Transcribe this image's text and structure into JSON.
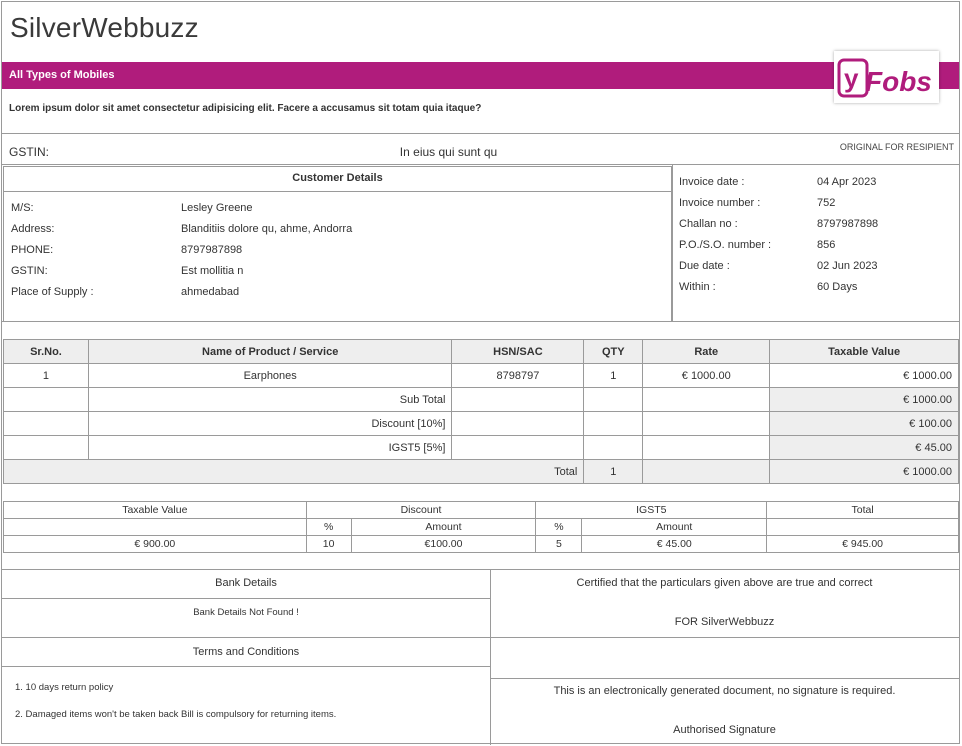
{
  "header": {
    "company_name": "SilverWebbuzz",
    "band_text": "All Types of Mobiles",
    "tagline": "Lorem ipsum dolor sit amet consectetur adipisicing elit. Facere a accusamus sit totam quia itaque?",
    "logo_text_y": "y",
    "logo_text_rest": "Fobs",
    "brand_color": "#b01c7c"
  },
  "gstin_bar": {
    "label": "GSTIN:",
    "value": "In eius qui sunt qu",
    "original_label": "ORIGINAL FOR RESIPIENT"
  },
  "customer": {
    "title": "Customer Details",
    "rows": [
      {
        "label": "M/S:",
        "value": "Lesley Greene"
      },
      {
        "label": "Address:",
        "value": "Blanditiis dolore qu, ahme, Andorra"
      },
      {
        "label": "PHONE:",
        "value": "8797987898"
      },
      {
        "label": "GSTIN:",
        "value": "Est mollitia n"
      },
      {
        "label": "Place of Supply :",
        "value": "ahmedabad"
      }
    ]
  },
  "invoice_info": [
    {
      "label": "Invoice date :",
      "value": "04 Apr 2023"
    },
    {
      "label": "Invoice number :",
      "value": "752"
    },
    {
      "label": "Challan no :",
      "value": "8797987898"
    },
    {
      "label": "P.O./S.O. number :",
      "value": "856"
    },
    {
      "label": "Due date :",
      "value": "02 Jun 2023"
    },
    {
      "label": "Within :",
      "value": "60 Days"
    }
  ],
  "items_table": {
    "headers": [
      "Sr.No.",
      "Name of Product / Service",
      "HSN/SAC",
      "QTY",
      "Rate",
      "Taxable Value"
    ],
    "rows": [
      {
        "sr": "1",
        "name": "Earphones",
        "hsn": "8798797",
        "qty": "1",
        "rate": "€ 1000.00",
        "value": "€ 1000.00"
      }
    ],
    "subtotal_label": "Sub Total",
    "subtotal_value": "€ 1000.00",
    "discount_label": "Discount [10%]",
    "discount_value": "€ 100.00",
    "tax_label": "IGST5 [5%]",
    "tax_value": "€ 45.00",
    "total_label": "Total",
    "total_qty": "1",
    "total_value": "€ 1000.00"
  },
  "summary_table": {
    "h_taxable": "Taxable Value",
    "h_discount": "Discount",
    "h_tax": "IGST5",
    "h_total": "Total",
    "sub_pct": "%",
    "sub_amount": "Amount",
    "taxable": "€ 900.00",
    "discount_pct": "10",
    "discount_amount": "€100.00",
    "tax_pct": "5",
    "tax_amount": "€ 45.00",
    "total": "€ 945.00"
  },
  "footer": {
    "bank_title": "Bank Details",
    "bank_text": "Bank Details Not Found !",
    "terms_title": "Terms and Conditions",
    "terms": [
      "1. 10 days return policy",
      "2. Damaged items won't be taken back Bill is compulsory for returning items."
    ],
    "certified_text": "Certified that the particulars given above are true and correct",
    "for_company": "FOR SilverWebbuzz",
    "electronic_note": "This is an electronically generated document, no signature is required.",
    "signature_label": "Authorised Signature"
  }
}
